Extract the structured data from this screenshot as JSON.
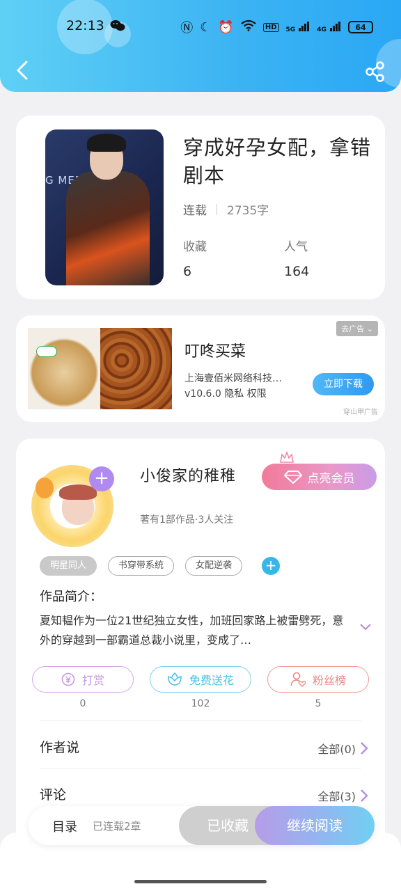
{
  "status_bar": {
    "time": "22:13",
    "network_hd": "HD",
    "net_5g": "5G",
    "net_4g": "4G",
    "battery": "64"
  },
  "book": {
    "title": "穿成好孕女配，拿错剧本",
    "status": "连载",
    "words": "2735字",
    "fav_label": "收藏",
    "fav_count": "6",
    "pop_label": "人气",
    "pop_count": "164",
    "cover_text": "G MEDIA"
  },
  "ad": {
    "title": "叮咚买菜",
    "company": "上海壹佰米网络科技…",
    "version": "v10.6.0  隐私  权限",
    "close_label": "去广告 ⌄",
    "download_label": "立即下载",
    "source": "穿山甲广告"
  },
  "author": {
    "name": "小俊家的稚稚",
    "sub": "著有1部作品·3人关注",
    "vip_label": "点亮会员",
    "tags": [
      "明星同人",
      "书穿带系统",
      "女配逆袭"
    ],
    "intro_heading": "作品简介：",
    "intro_text": "夏知韫作为一位21世纪独立女性，加班回家路上被雷劈死，意外的穿越到一部霸道总裁小说里，变成了…"
  },
  "actions": [
    {
      "label": "打赏",
      "count": "0"
    },
    {
      "label": "免费送花",
      "count": "102"
    },
    {
      "label": "粉丝榜",
      "count": "5"
    }
  ],
  "sections": {
    "author_says": {
      "label": "作者说",
      "all": "全部(0)"
    },
    "comments": {
      "label": "评论",
      "all": "全部(3)"
    }
  },
  "bottom_bar": {
    "toc": "目录",
    "chapters": "已连载2章",
    "collected": "已收藏",
    "continue": "继续阅读"
  },
  "colors": {
    "header": "#3bb3f3",
    "accent_purple": "#b08af0",
    "vip_pink": "#f27a9a"
  }
}
